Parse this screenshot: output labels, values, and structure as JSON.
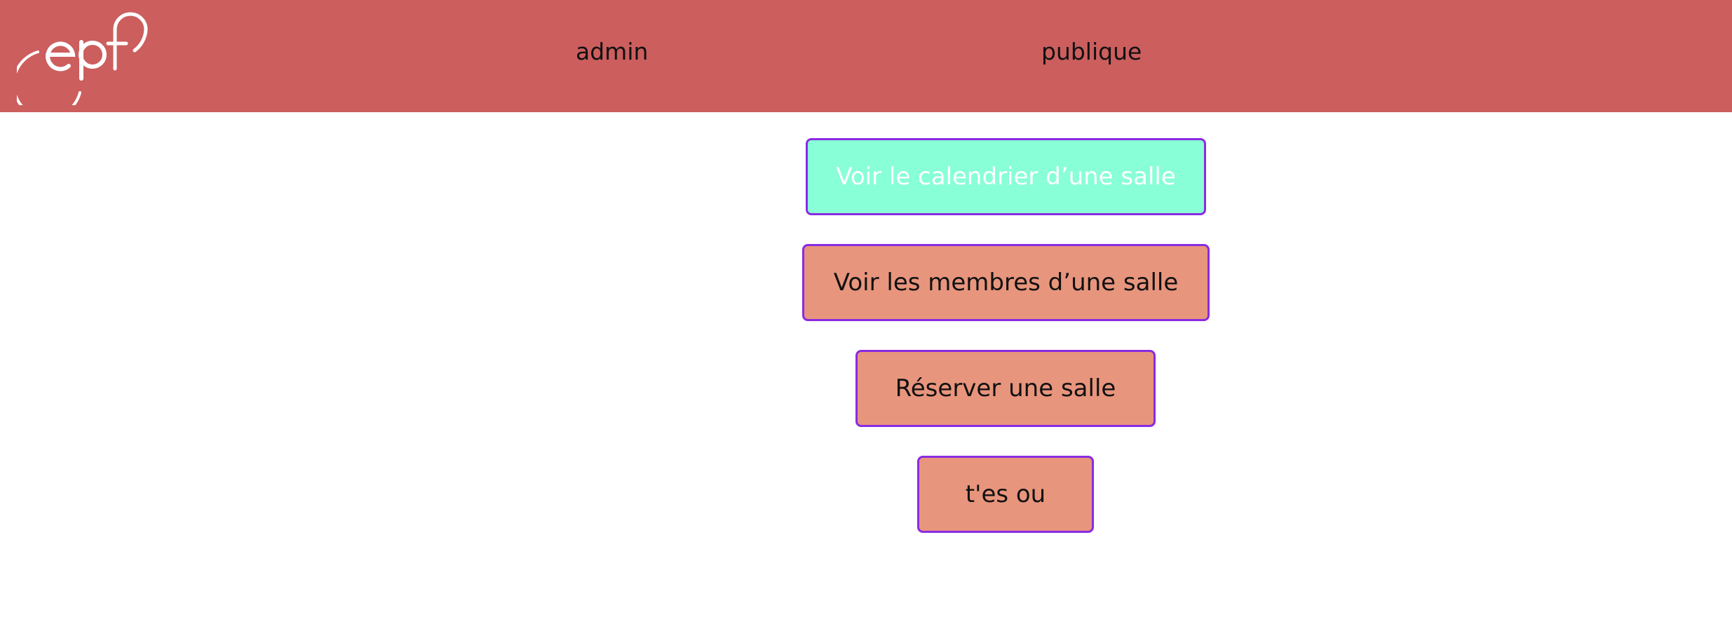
{
  "header": {
    "logo_text": "epf",
    "colors": {
      "background": "#cc5e5e",
      "logo": "#ffffff"
    },
    "nav": [
      {
        "label": "admin"
      },
      {
        "label": "publique"
      }
    ]
  },
  "main": {
    "buttons": [
      {
        "label": "Voir le calendrier d’une salle",
        "bg": "#88ffd6",
        "fg": "#ffffff"
      },
      {
        "label": "Voir les membres d’une salle",
        "bg": "#e8957d",
        "fg": "#111111"
      },
      {
        "label": "Réserver une salle",
        "bg": "#e8957d",
        "fg": "#111111"
      },
      {
        "label": "t'es ou",
        "bg": "#e8957d",
        "fg": "#111111"
      }
    ],
    "button_border_color": "#8a2be2"
  }
}
